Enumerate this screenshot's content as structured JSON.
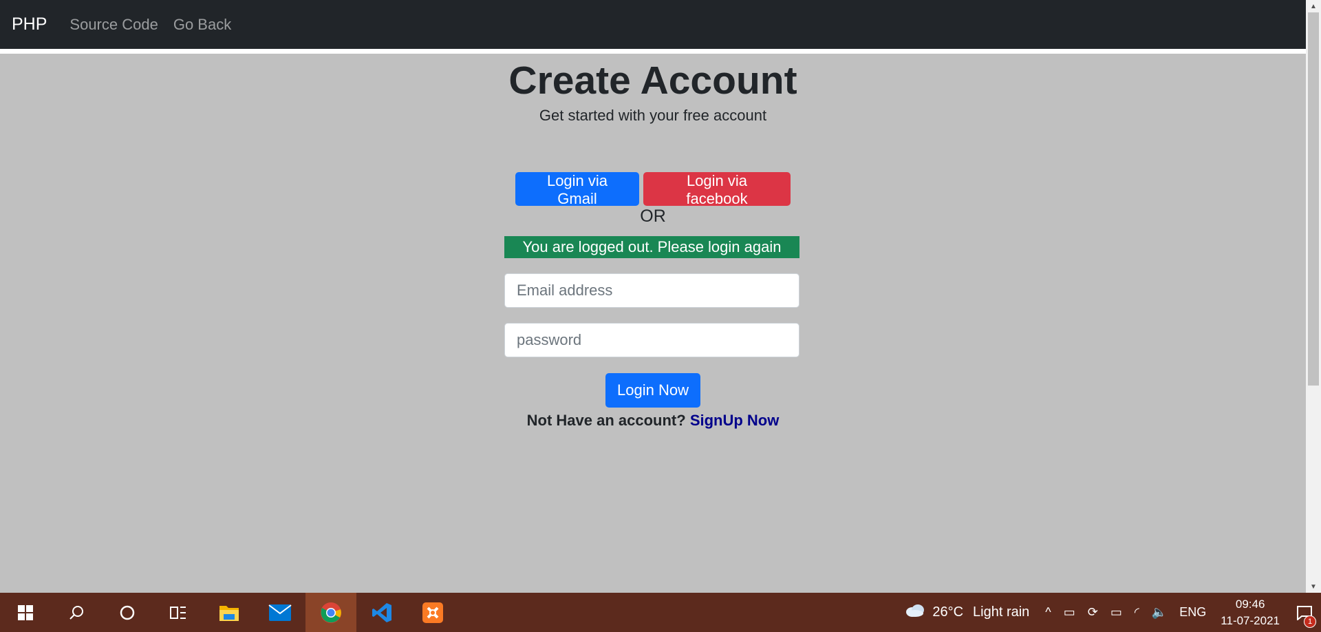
{
  "navbar": {
    "brand": "PHP",
    "links": [
      "Source Code",
      "Go Back"
    ]
  },
  "page": {
    "title": "Create Account",
    "subtitle": "Get started with your free account",
    "gmail_button": "Login via Gmail",
    "facebook_button": "Login via facebook",
    "or_text": "OR",
    "alert": "You are logged out. Please login again",
    "email_placeholder": "Email address",
    "password_placeholder": "password",
    "login_button": "Login Now",
    "signup_prompt": "Not Have an account?",
    "signup_link": "SignUp Now"
  },
  "colors": {
    "primary": "#0d6efd",
    "danger": "#dc3545",
    "success": "#198754",
    "background": "#c0c0c0"
  },
  "taskbar": {
    "apps": [
      "windows-start-icon",
      "search-icon",
      "cortana-icon",
      "task-view-icon",
      "file-explorer-icon",
      "mail-icon",
      "chrome-icon",
      "vscode-icon",
      "xampp-icon"
    ],
    "weather_temp": "26°C",
    "weather_text": "Light rain",
    "language": "ENG",
    "time": "09:46",
    "date": "11-07-2021",
    "notification_count": "1"
  }
}
